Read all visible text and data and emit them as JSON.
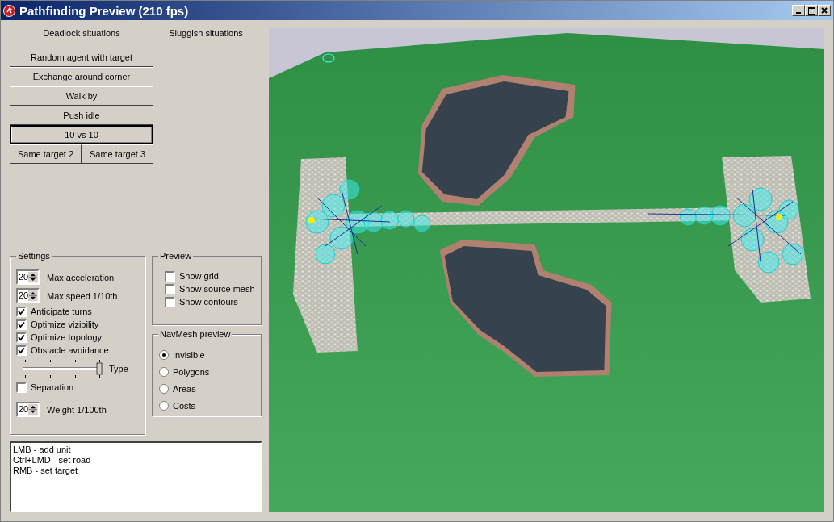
{
  "window": {
    "title": "Pathfinding Preview (210 fps)"
  },
  "situations": {
    "deadlock_heading": "Deadlock situations",
    "sluggish_heading": "Sluggish situations",
    "buttons": [
      {
        "label": "Random agent with target",
        "focused": false
      },
      {
        "label": "Exchange around corner",
        "focused": false
      },
      {
        "label": "Walk by",
        "focused": false
      },
      {
        "label": "Push idle",
        "focused": false
      },
      {
        "label": "10 vs 10",
        "focused": true
      }
    ],
    "pair_buttons": [
      "Same target 2",
      "Same target 3"
    ]
  },
  "settings": {
    "title": "Settings",
    "items": [
      {
        "kind": "spin",
        "value": "20",
        "label": "Max acceleration"
      },
      {
        "kind": "spin",
        "value": "20",
        "label": "Max speed 1/10th"
      },
      {
        "kind": "check",
        "label": "Anticipate turns",
        "checked": true
      },
      {
        "kind": "check",
        "label": "Optimize vizibility",
        "checked": true
      },
      {
        "kind": "check",
        "label": "Optimize topology",
        "checked": true
      },
      {
        "kind": "check",
        "label": "Obstacle avoidance",
        "checked": true
      },
      {
        "kind": "slider",
        "label": "Type",
        "level": 1
      },
      {
        "kind": "check",
        "label": "Separation",
        "checked": false
      },
      {
        "kind": "spin",
        "value": "20",
        "label": "Weight 1/100th"
      }
    ]
  },
  "preview": {
    "title": "Preview",
    "options": [
      {
        "label": "Show grid",
        "checked": false
      },
      {
        "label": "Show source mesh",
        "checked": false
      },
      {
        "label": "Show contours",
        "checked": false
      }
    ]
  },
  "navmesh_preview": {
    "title": "NavMesh preview",
    "options": [
      {
        "label": "Invisible",
        "selected": true
      },
      {
        "label": "Polygons",
        "selected": false
      },
      {
        "label": "Areas",
        "selected": false
      },
      {
        "label": "Costs",
        "selected": false
      }
    ]
  },
  "help_text": [
    "LMB - add unit",
    "Ctrl+LMD - set road",
    "RMB - set target"
  ]
}
